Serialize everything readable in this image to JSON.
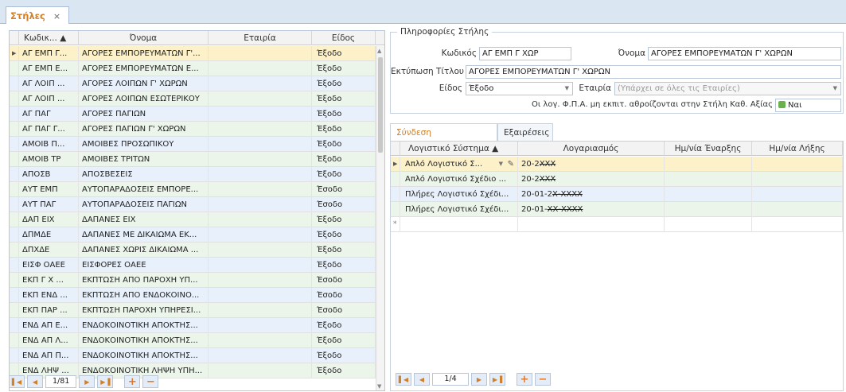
{
  "tab": {
    "label": "Στήλες",
    "close": "×"
  },
  "left_grid": {
    "columns": [
      "Κωδικ... ▲",
      "Όνομα",
      "Εταιρία",
      "Είδος"
    ],
    "rows": [
      {
        "code": "ΑΓ ΕΜΠ Γ...",
        "name": "ΑΓΟΡΕΣ ΕΜΠΟΡΕΥΜΑΤΩΝ Γ'...",
        "company": "",
        "type": "Έξοδο"
      },
      {
        "code": "ΑΓ ΕΜΠ Ε...",
        "name": "ΑΓΟΡΕΣ ΕΜΠΟΡΕΥΜΑΤΩΝ Ε...",
        "company": "",
        "type": "Έξοδο"
      },
      {
        "code": "ΑΓ ΛΟΙΠ ...",
        "name": "ΑΓΟΡΕΣ ΛΟΙΠΩΝ  Γ' ΧΩΡΩΝ",
        "company": "",
        "type": "Έξοδο"
      },
      {
        "code": "ΑΓ ΛΟΙΠ ...",
        "name": "ΑΓΟΡΕΣ ΛΟΙΠΩΝ ΕΣΩΤΕΡΙΚΟΥ",
        "company": "",
        "type": "Έξοδο"
      },
      {
        "code": "ΑΓ ΠΑΓ",
        "name": "ΑΓΟΡΕΣ ΠΑΓΙΩΝ",
        "company": "",
        "type": "Έξοδο"
      },
      {
        "code": "ΑΓ ΠΑΓ Γ...",
        "name": "ΑΓΟΡΕΣ ΠΑΓΙΩΝ Γ' ΧΩΡΩΝ",
        "company": "",
        "type": "Έξοδο"
      },
      {
        "code": "ΑΜΟΙΒ Π...",
        "name": "ΑΜΟΙΒΕΣ ΠΡΟΣΩΠΙΚΟΥ",
        "company": "",
        "type": "Έξοδο"
      },
      {
        "code": "ΑΜΟΙΒ ΤΡ",
        "name": "ΑΜΟΙΒΕΣ ΤΡΙΤΩΝ",
        "company": "",
        "type": "Έξοδο"
      },
      {
        "code": "ΑΠΟΣΒ",
        "name": "ΑΠΟΣΒΕΣΕΙΣ",
        "company": "",
        "type": "Έξοδο"
      },
      {
        "code": "ΑΥΤ ΕΜΠ",
        "name": "ΑΥΤΟΠΑΡΑΔΟΣΕΙΣ ΕΜΠΟΡΕ...",
        "company": "",
        "type": "Έσοδο"
      },
      {
        "code": "ΑΥΤ ΠΑΓ",
        "name": "ΑΥΤΟΠΑΡΑΔΟΣΕΙΣ ΠΑΓΙΩΝ",
        "company": "",
        "type": "Έσοδο"
      },
      {
        "code": "ΔΑΠ ΕΙΧ",
        "name": "ΔΑΠΑΝΕΣ ΕΙΧ",
        "company": "",
        "type": "Έξοδο"
      },
      {
        "code": "ΔΠΜΔΕ",
        "name": "ΔΑΠΑΝΕΣ ΜΕ ΔΙΚΑΙΩΜΑ ΕΚ...",
        "company": "",
        "type": "Έξοδο"
      },
      {
        "code": "ΔΠΧΔΕ",
        "name": "ΔΑΠΑΝΕΣ ΧΩΡΙΣ ΔΙΚΑΙΩΜΑ ...",
        "company": "",
        "type": "Έξοδο"
      },
      {
        "code": "ΕΙΣΦ ΟΑΕΕ",
        "name": "ΕΙΣΦΟΡΕΣ ΟΑΕΕ",
        "company": "",
        "type": "Έξοδο"
      },
      {
        "code": "ΕΚΠ Γ Χ ...",
        "name": "ΕΚΠΤΩΣΗ ΑΠΟ ΠΑΡΟΧΗ ΥΠ...",
        "company": "",
        "type": "Έσοδο"
      },
      {
        "code": "ΕΚΠ ΕΝΔ ...",
        "name": "ΕΚΠΤΩΣΗ ΑΠΟ ΕΝΔΟΚΟΙΝΟ...",
        "company": "",
        "type": "Έσοδο"
      },
      {
        "code": "ΕΚΠ ΠΑΡ ...",
        "name": "ΕΚΠΤΩΣΗ ΠΑΡΟΧΗ ΥΠΗΡΕΣΙ...",
        "company": "",
        "type": "Έσοδο"
      },
      {
        "code": "ΕΝΔ ΑΠ Ε...",
        "name": "ΕΝΔΟΚΟΙΝΟΤΙΚΗ ΑΠΟΚΤΗΣ...",
        "company": "",
        "type": "Έξοδο"
      },
      {
        "code": "ΕΝΔ ΑΠ Λ...",
        "name": "ΕΝΔΟΚΟΙΝΟΤΙΚΗ ΑΠΟΚΤΗΣ...",
        "company": "",
        "type": "Έξοδο"
      },
      {
        "code": "ΕΝΔ ΑΠ Π...",
        "name": "ΕΝΔΟΚΟΙΝΟΤΙΚΗ ΑΠΟΚΤΗΣ...",
        "company": "",
        "type": "Έξοδο"
      },
      {
        "code": "ΕΝΔ ΛΗΨ ...",
        "name": "ΕΝΔΟΚΟΙΝΟΤΙΚΗ ΛΗΨΗ ΥΠΗ...",
        "company": "",
        "type": "Έξοδο"
      }
    ]
  },
  "left_nav": {
    "position": "1/81"
  },
  "info": {
    "group_title": "Πληροφορίες Στήλης",
    "code_label": "Κωδικός",
    "code_value": "ΑΓ ΕΜΠ Γ ΧΩΡ",
    "name_label": "Όνομα",
    "name_value": "ΑΓΟΡΕΣ ΕΜΠΟΡΕΥΜΑΤΩΝ Γ' ΧΩΡΩΝ",
    "print_label": "Εκτύπωση Τίτλου",
    "print_value": "ΑΓΟΡΕΣ ΕΜΠΟΡΕΥΜΑΤΩΝ Γ' ΧΩΡΩΝ",
    "type_label": "Είδος",
    "type_value": "Έξοδο",
    "company_label": "Εταιρία",
    "company_placeholder": "(Υπάρχει σε όλες τις Εταιρίες)",
    "vat_label": "Οι λογ. Φ.Π.Α. μη εκπιτ. αθροίζονται στην Στήλη Καθ. Αξίας",
    "vat_value": "Ναι"
  },
  "inner_tabs": {
    "tab1": "Σύνδεση Λογαριασμών",
    "tab2": "Εξαιρέσεις"
  },
  "right_grid": {
    "columns": [
      "Λογιστικό Σύστημα  ▲",
      "Λογαριασμός",
      "Ημ/νία Έναρξης",
      "Ημ/νία Λήξης"
    ],
    "rows": [
      {
        "system": "Απλό Λογιστικό Σ...",
        "acc_prefix": "20-2",
        "acc_strike": "ΧΧΧ",
        "start": "",
        "end": ""
      },
      {
        "system": "Απλό Λογιστικό Σχέδιο ...",
        "acc_prefix": "20-2",
        "acc_strike": "ΧΧΧ",
        "start": "",
        "end": ""
      },
      {
        "system": "Πλήρες Λογιστικό Σχέδι...",
        "acc_prefix": "20-01-2",
        "acc_strike": "Χ-ΧΧΧΧ",
        "start": "",
        "end": ""
      },
      {
        "system": "Πλήρες Λογιστικό Σχέδι...",
        "acc_prefix": "20-01-",
        "acc_strike": "ΧΧ-ΧΧΧΧ",
        "start": "",
        "end": ""
      }
    ]
  },
  "right_nav": {
    "position": "1/4"
  }
}
